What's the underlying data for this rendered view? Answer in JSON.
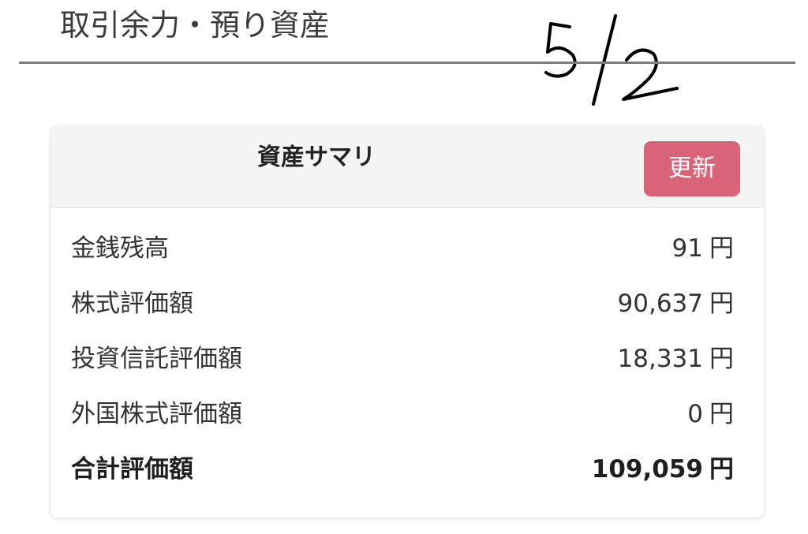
{
  "page": {
    "title": "取引余力・預り資産",
    "handwritten_date": "5/2"
  },
  "summary": {
    "title": "資産サマリ",
    "refresh_label": "更新",
    "unit": "円",
    "rows": [
      {
        "label": "金銭残高",
        "value": "91"
      },
      {
        "label": "株式評価額",
        "value": "90,637"
      },
      {
        "label": "投資信託評価額",
        "value": "18,331"
      },
      {
        "label": "外国株式評価額",
        "value": "0"
      },
      {
        "label": "合計評価額",
        "value": "109,059",
        "emphasis": true
      }
    ]
  },
  "colors": {
    "accent": "#d9647a",
    "header_bg": "#f4f4f4",
    "rule": "#7d7d7d",
    "ink": "#000000"
  }
}
